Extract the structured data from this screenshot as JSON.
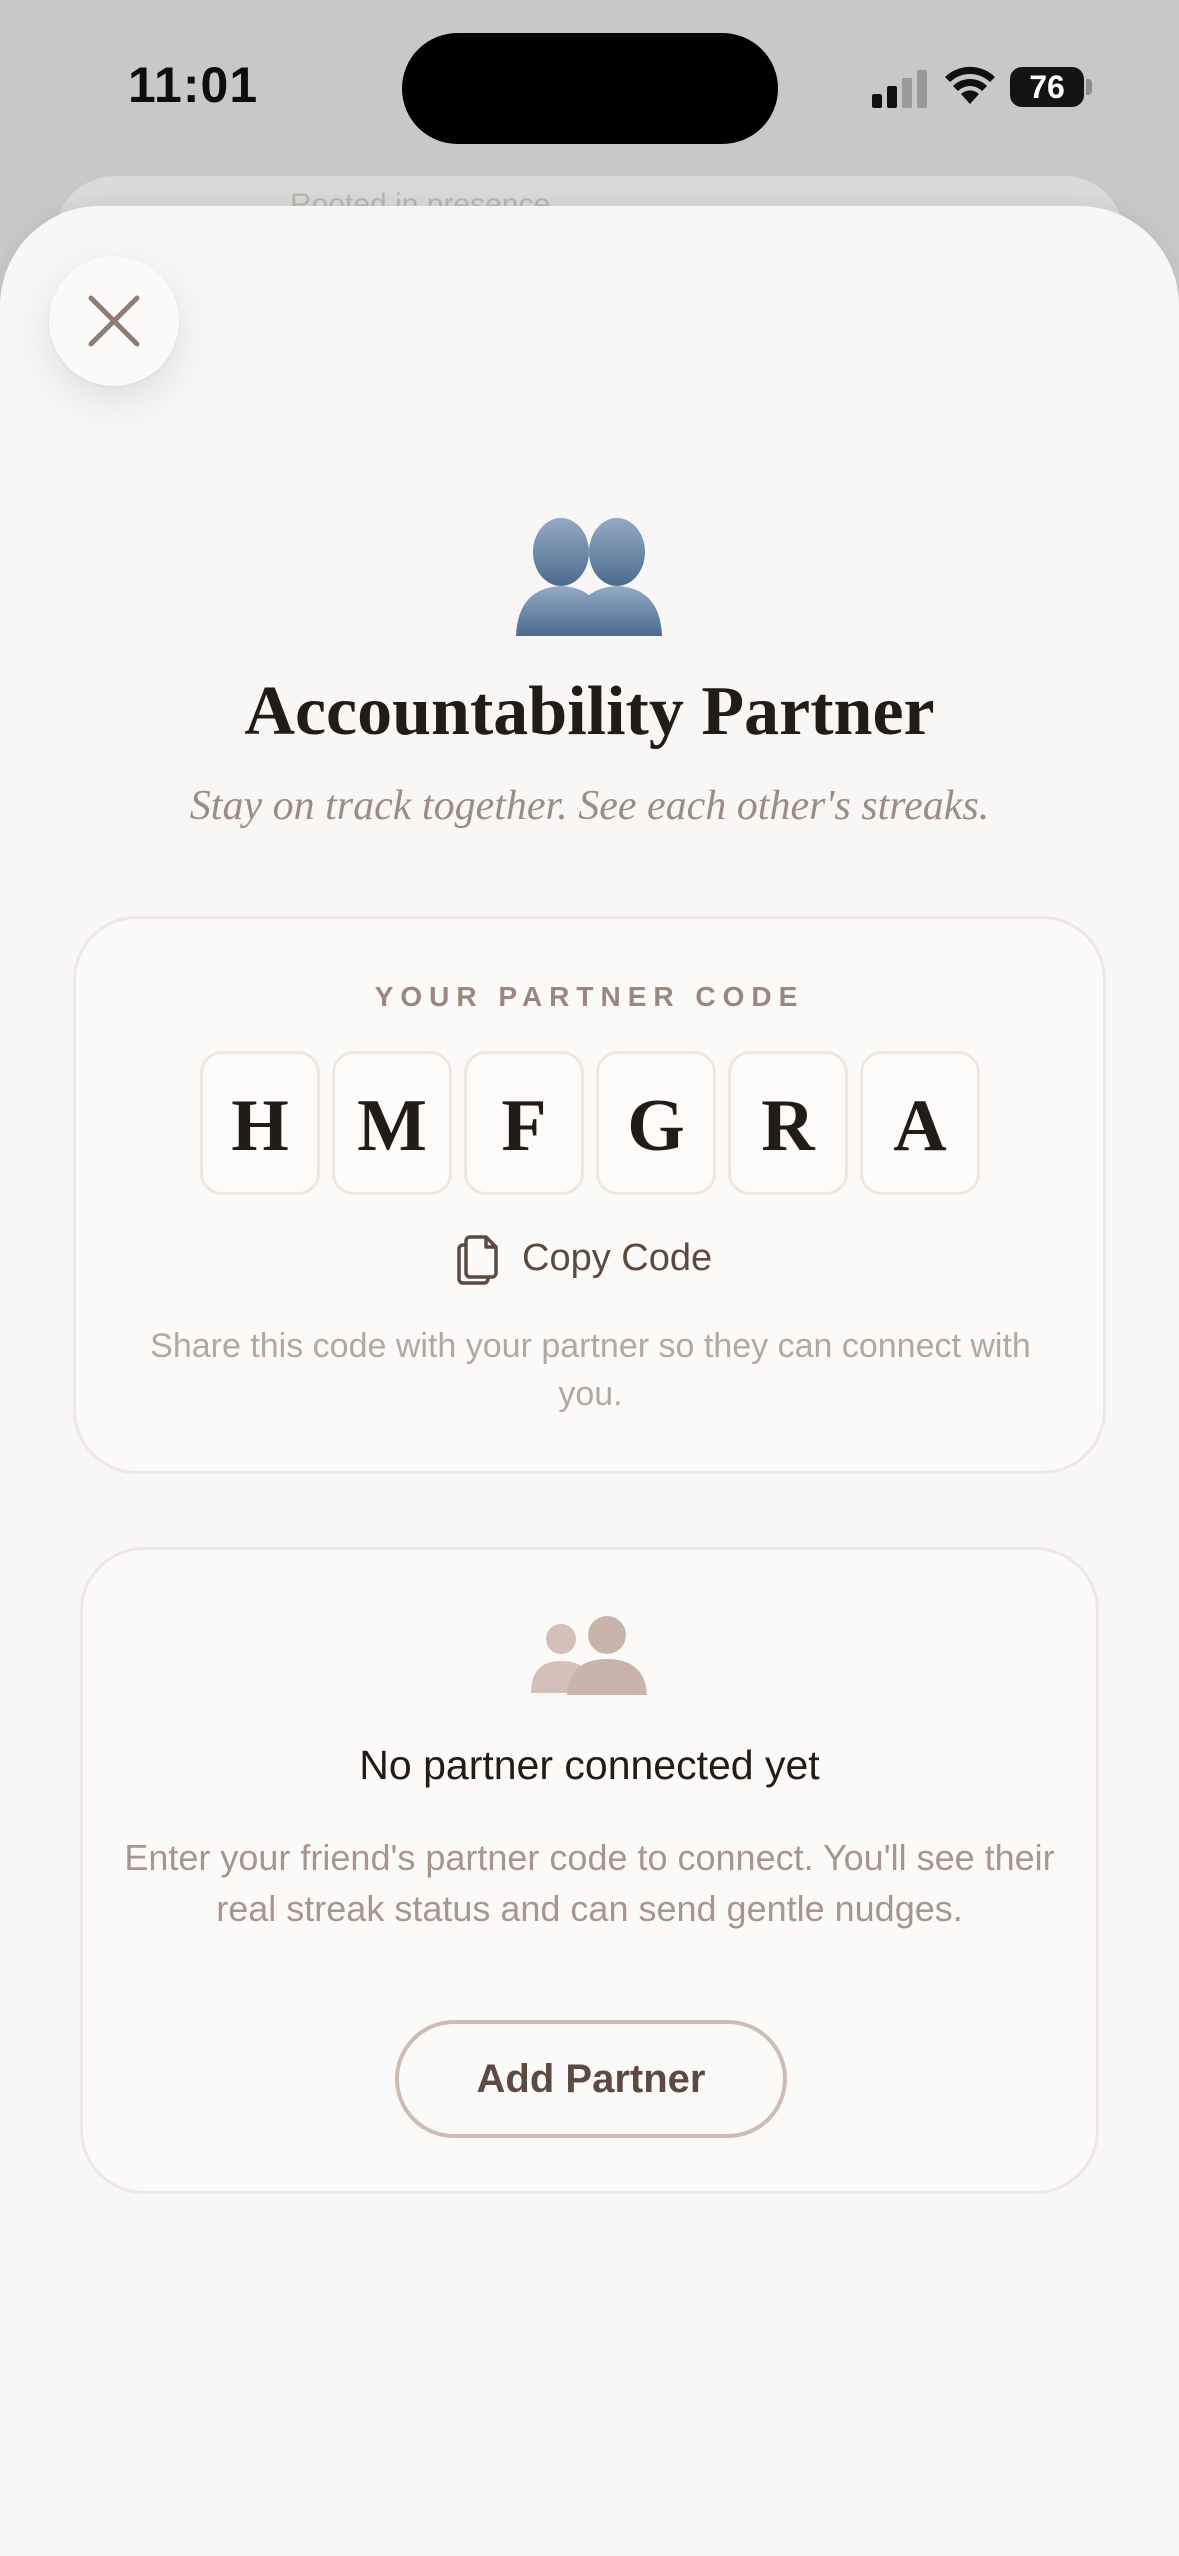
{
  "status_bar": {
    "time": "11:01",
    "battery": "76"
  },
  "behind_sheet": {
    "text": "Rooted in presence"
  },
  "sheet": {
    "title": "Accountability Partner",
    "subtitle": "Stay on track together. See each other's streaks.",
    "hero_icon": "two-people-silhouette-icon"
  },
  "partner_code": {
    "label": "YOUR PARTNER CODE",
    "letters": [
      "H",
      "M",
      "F",
      "G",
      "R",
      "A"
    ],
    "copy_label": "Copy Code",
    "copy_icon": "copy-icon",
    "help": "Share this code with your partner so they can connect with you."
  },
  "partner_status": {
    "icon": "people-icon",
    "title": "No partner connected yet",
    "help": "Enter your friend's partner code to connect. You'll see their real streak status and can send gentle nudges.",
    "add_button": "Add Partner"
  },
  "colors": {
    "background": "#f8f7f6",
    "title": "#231b18",
    "accent_brown": "#5b4942",
    "muted": "#a7968f",
    "hero_icon_blue": "#5d7a9c"
  }
}
